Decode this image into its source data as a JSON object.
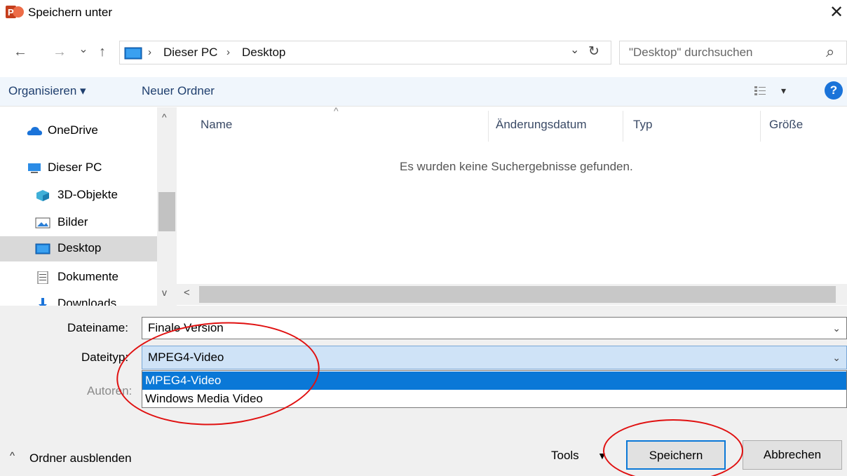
{
  "window": {
    "title": "Speichern unter",
    "app_icon_letter": "P",
    "close_glyph": "✕"
  },
  "nav_buttons": {
    "back": "←",
    "forward": "→",
    "recent": "⌄",
    "up": "↑",
    "refresh": "↻"
  },
  "address": {
    "crumbs": [
      "Dieser PC",
      "Desktop"
    ],
    "separator": "›",
    "dropdown": "⌄"
  },
  "search": {
    "placeholder": "\"Desktop\" durchsuchen",
    "icon": "⌕"
  },
  "toolbar": {
    "organize": "Organisieren ▾",
    "new_folder": "Neuer Ordner",
    "view_glyph": "▾",
    "help": "?"
  },
  "nav_pane": {
    "items": [
      {
        "label": "OneDrive",
        "icon": "cloud-icon"
      },
      {
        "label": "Dieser PC",
        "icon": "computer-icon"
      },
      {
        "label": "3D-Objekte",
        "icon": "cube-icon"
      },
      {
        "label": "Bilder",
        "icon": "picture-icon"
      },
      {
        "label": "Desktop",
        "icon": "desktop-icon",
        "selected": true
      },
      {
        "label": "Dokumente",
        "icon": "document-icon"
      },
      {
        "label": "Downloads",
        "icon": "download-icon"
      }
    ]
  },
  "list": {
    "columns": [
      "Name",
      "Änderungsdatum",
      "Typ",
      "Größe"
    ],
    "sort_glyph": "^",
    "empty_message": "Es wurden keine Suchergebnisse gefunden."
  },
  "form": {
    "filename_label": "Dateiname:",
    "filename_value": "Finale Version",
    "filetype_label": "Dateityp:",
    "filetype_value": "MPEG4-Video",
    "authors_label": "Autoren:",
    "filetype_options": [
      "MPEG4-Video",
      "Windows Media Video"
    ],
    "selected_option_index": 0
  },
  "footer": {
    "hide_folders": "Ordner ausblenden",
    "tools": "Tools",
    "save": "Speichern",
    "cancel": "Abbrechen"
  },
  "colors": {
    "accent": "#0a78d7",
    "annotation": "#e01010",
    "toolbar_bg": "#f0f6fc",
    "form_bg": "#f0f0f0"
  }
}
